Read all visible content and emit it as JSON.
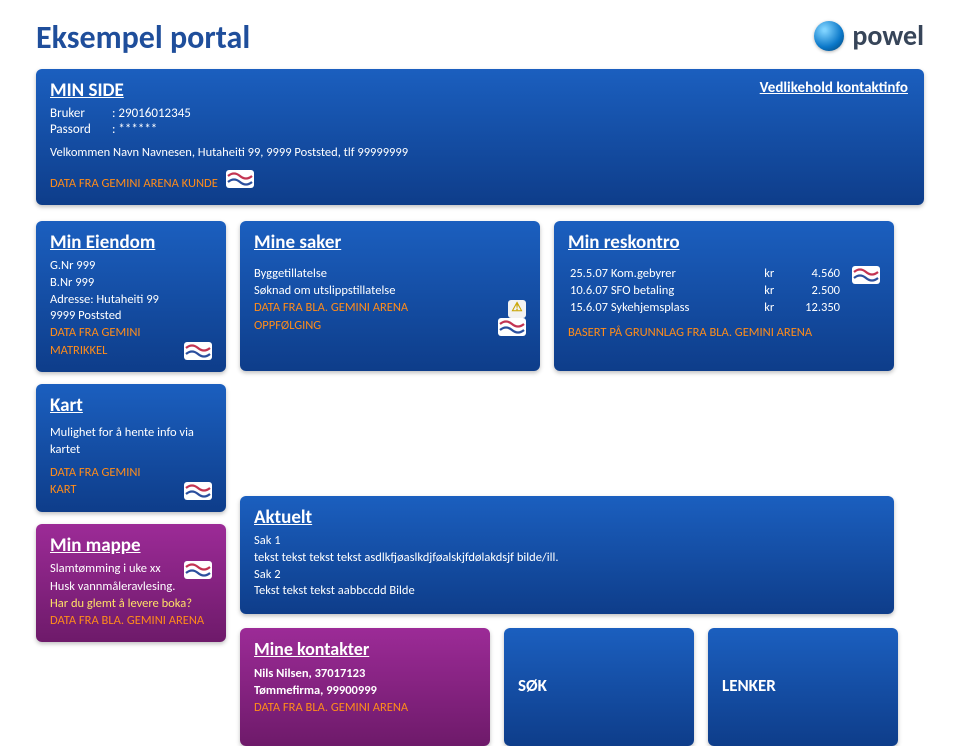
{
  "pageTitle": "Eksempel portal",
  "brand": "powel",
  "minside": {
    "title": "MIN SIDE",
    "brukerLabel": "Bruker",
    "brukerValue": ": 29016012345",
    "passordLabel": "Passord",
    "passordValue": ": ******",
    "vedlikehold": "Vedlikehold kontaktinfo",
    "velkommen": "Velkommen Navn Navnesen, Hutaheiti 99, 9999 Poststed, tlf 99999999",
    "source": "DATA FRA GEMINI ARENA KUNDE"
  },
  "eiendom": {
    "title": "Min Eiendom",
    "l1": "G.Nr 999",
    "l2": "B.Nr 999",
    "l3": "Adresse: Hutaheiti 99",
    "l4": "9999 Poststed",
    "src1": "DATA FRA GEMINI",
    "src2": "MATRIKKEL"
  },
  "kart": {
    "title": "Kart",
    "l1": "Mulighet for å hente info via kartet",
    "src1": "DATA FRA GEMINI",
    "src2": "KART"
  },
  "mappe": {
    "title": "Min mappe",
    "l1": "Slamtømming i uke xx",
    "l2": "Husk vannmåleravlesing.",
    "l3": "Har du glemt å levere boka?",
    "src": "DATA FRA BLA. GEMINI ARENA"
  },
  "saker": {
    "title": "Mine saker",
    "l1": "Byggetillatelse",
    "l2": "Søknad om utslippstillatelse",
    "src": "DATA FRA BLA. GEMINI ARENA",
    "opp": "OPPFØLGING"
  },
  "aktuelt": {
    "title": "Aktuelt",
    "s1": "Sak 1",
    "s1t": "tekst tekst tekst tekst asdlkfjøaslkdjføalskjfdølakdsjf",
    "s1r": "bilde/ill.",
    "s2": "Sak 2",
    "s2t": "Tekst tekst tekst aabbccdd",
    "s2r": "Bilde"
  },
  "kontakter": {
    "title": "Mine kontakter",
    "l1": "Nils Nilsen, 37017123",
    "l2": "Tømmefirma, 99900999",
    "src": "DATA FRA BLA. GEMINI ARENA"
  },
  "reskontro": {
    "title": "Min reskontro",
    "rows": [
      {
        "d": "25.5.07 Kom.gebyrer",
        "p": "kr",
        "v": "4.560"
      },
      {
        "d": "10.6.07 SFO betaling",
        "p": "kr",
        "v": "2.500"
      },
      {
        "d": "15.6.07 Sykehjemsplass",
        "p": "kr",
        "v": "12.350"
      }
    ],
    "src": "BASERT PÅ GRUNNLAG FRA BLA. GEMINI ARENA"
  },
  "sok": "SØK",
  "lenker": "LENKER"
}
